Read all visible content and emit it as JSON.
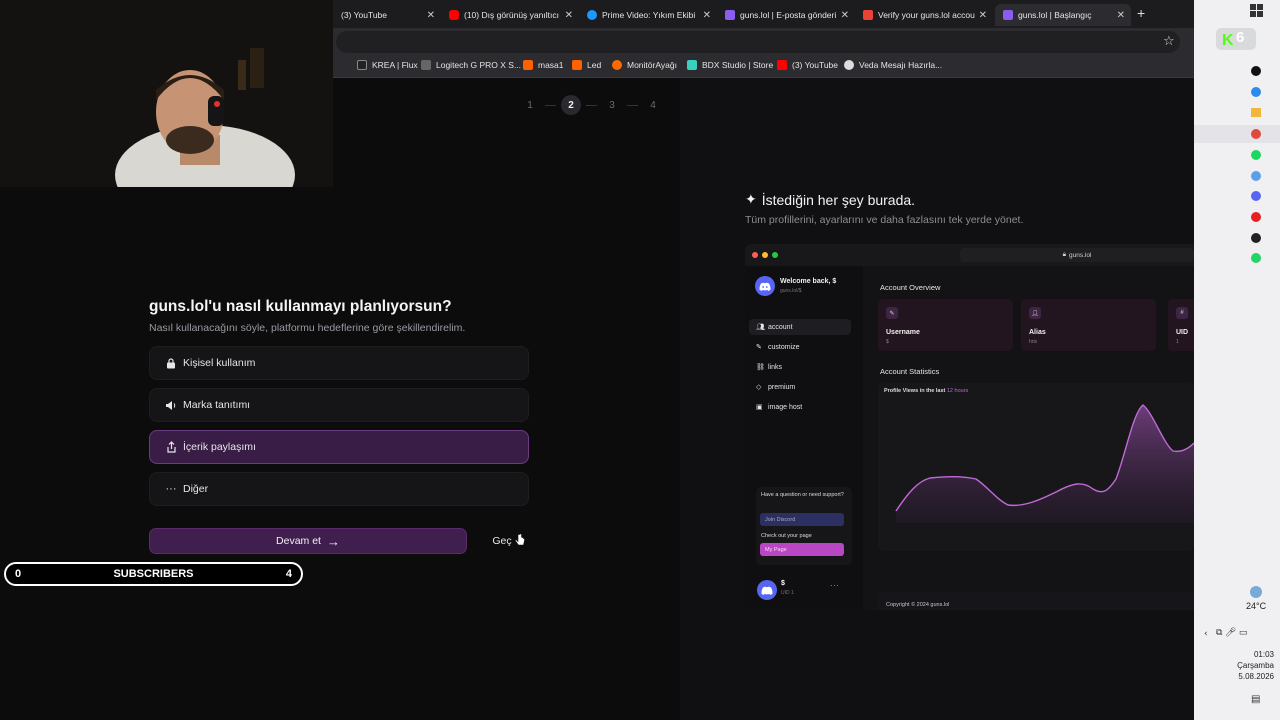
{
  "browser": {
    "tabs": [
      {
        "label": "(3) YouTube",
        "color": "#ff0000"
      },
      {
        "label": "(10) Dış görünüş yanıltıcı",
        "color": "#ff0000"
      },
      {
        "label": "Prime Video: Yıkım Ekibi",
        "color": "#1a98ff"
      },
      {
        "label": "guns.lol | E-posta gönderi",
        "color": "#8a5cf0"
      },
      {
        "label": "Verify your guns.lol accou",
        "color": "#ea4335"
      },
      {
        "label": "guns.lol | Başlangıç",
        "color": "#8a5cf0"
      }
    ],
    "bookmarks": [
      {
        "label": "KREA | Flux",
        "color": "#ffffff"
      },
      {
        "label": "Logitech G PRO X S...",
        "color": "#bbbbbb"
      },
      {
        "label": "masa1",
        "color": "#ff6000"
      },
      {
        "label": "Led",
        "color": "#ff6000"
      },
      {
        "label": "MonitörAyağı",
        "color": "#ff6a00"
      },
      {
        "label": "BDX Studio | Store",
        "color": "#3ad0c0"
      },
      {
        "label": "(3) YouTube",
        "color": "#ff0000"
      },
      {
        "label": "Veda Mesajı Hazırla...",
        "color": "#dddddd"
      }
    ]
  },
  "onboarding": {
    "steps": [
      "1",
      "2",
      "3",
      "4"
    ],
    "active_step": 2,
    "question": "guns.lol'u nasıl kullanmayı planlıyorsun?",
    "subtitle": "Nasıl kullanacağını söyle, platformu hedeflerine göre şekillendirelim.",
    "options": [
      {
        "label": "Kişisel kullanım",
        "icon": "lock-icon"
      },
      {
        "label": "Marka tanıtımı",
        "icon": "megaphone-icon"
      },
      {
        "label": "İçerik paylaşımı",
        "icon": "share-icon",
        "selected": true
      },
      {
        "label": "Diğer",
        "icon": "more-icon"
      }
    ],
    "continue_label": "Devam et",
    "continue_arrow": "→",
    "skip_label": "Geç"
  },
  "subscriber_bar": {
    "left": "0",
    "label": "SUBSCRIBERS",
    "right": "4"
  },
  "preview": {
    "title": "İstediğin her şey burada.",
    "subtitle": "Tüm profillerini, ayarlarını ve daha fazlasını tek yerde yönet.",
    "url": "guns.lol",
    "welcome": "Welcome back, $",
    "welcome_sub": "guns.lol/$",
    "nav": [
      {
        "label": "account",
        "active": true
      },
      {
        "label": "customize"
      },
      {
        "label": "links"
      },
      {
        "label": "premium"
      },
      {
        "label": "image host"
      }
    ],
    "help_text": "Have a question or need support?",
    "help_button": "Join Discord",
    "page_text": "Check out your page",
    "page_button": "My Page",
    "user_name": "$",
    "user_uid": "UID 1",
    "overview_title": "Account Overview",
    "cards": [
      {
        "label": "Username",
        "value": "$"
      },
      {
        "label": "Alias",
        "value": "hris"
      },
      {
        "label": "UID",
        "value": "1"
      }
    ],
    "stats_title": "Account Statistics",
    "stats_chart_title": "Profile Views in the last",
    "stats_chart_period": "12 hours",
    "footer": "Copyright © 2024 guns.lol"
  },
  "system": {
    "temperature": "24°C",
    "time": "01:03",
    "day": "Çarşamba",
    "date": "5.08.2026",
    "k_badge": "6"
  }
}
